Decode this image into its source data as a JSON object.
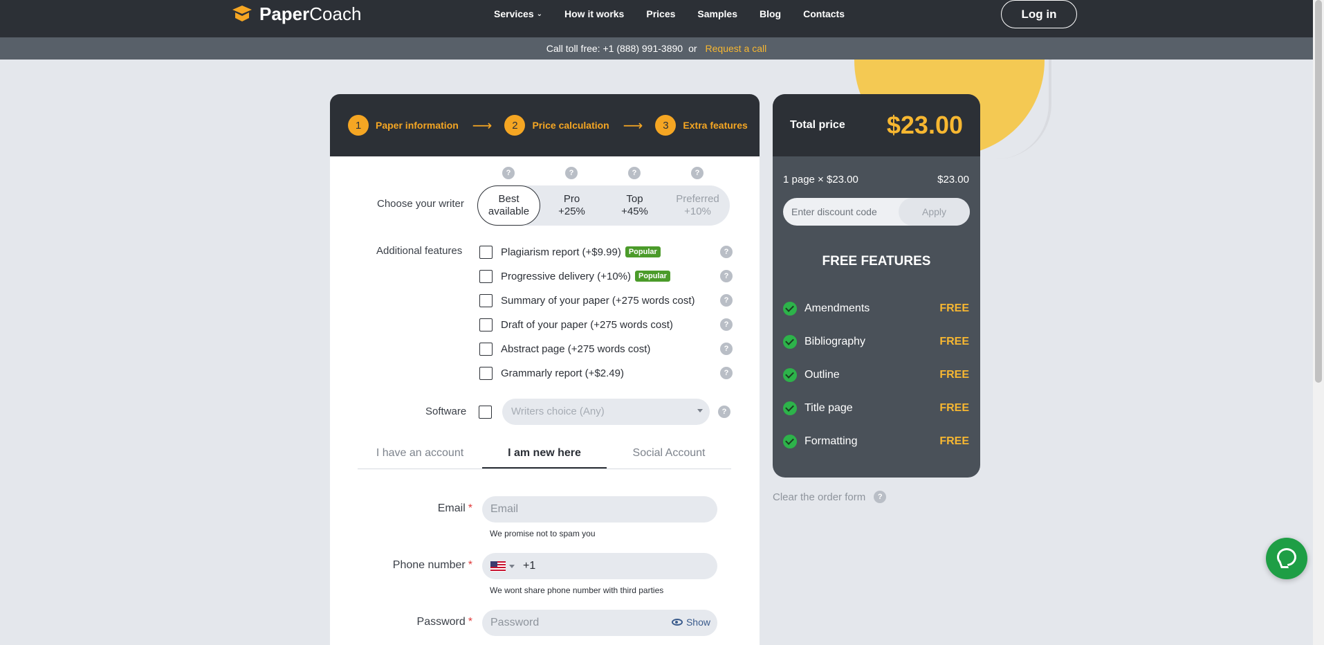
{
  "header": {
    "brand_bold": "Paper",
    "brand_thin": "Coach",
    "nav": [
      "Services",
      "How it works",
      "Prices",
      "Samples",
      "Blog",
      "Contacts"
    ],
    "login_label": "Log in"
  },
  "subbar": {
    "call_text": "Call toll free: +1 (888) 991-3890",
    "or_text": "or",
    "request_label": "Request a call"
  },
  "steps": [
    {
      "num": "1",
      "label": "Paper information"
    },
    {
      "num": "2",
      "label": "Price calculation"
    },
    {
      "num": "3",
      "label": "Extra features"
    }
  ],
  "writer": {
    "label": "Choose your writer",
    "options": [
      {
        "line1": "Best",
        "line2": "available",
        "state": "selected"
      },
      {
        "line1": "Pro",
        "line2": "+25%",
        "state": "normal"
      },
      {
        "line1": "Top",
        "line2": "+45%",
        "state": "normal"
      },
      {
        "line1": "Preferred",
        "line2": "+10%",
        "state": "disabled"
      }
    ]
  },
  "features": {
    "label": "Additional features",
    "popular_badge": "Popular",
    "items": [
      {
        "label": "Plagiarism report (+$9.99)",
        "popular": true
      },
      {
        "label": "Progressive delivery (+10%)",
        "popular": true
      },
      {
        "label": "Summary of your paper (+275 words cost)",
        "popular": false
      },
      {
        "label": "Draft of your paper (+275 words cost)",
        "popular": false
      },
      {
        "label": "Abstract page (+275 words cost)",
        "popular": false
      },
      {
        "label": "Grammarly report (+$2.49)",
        "popular": false
      }
    ]
  },
  "software": {
    "label": "Software",
    "placeholder": "Writers choice (Any)"
  },
  "account_tabs": [
    "I have an account",
    "I am new here",
    "Social Account"
  ],
  "form": {
    "email_label": "Email",
    "email_placeholder": "Email",
    "email_hint": "We promise not to spam you",
    "phone_label": "Phone number",
    "phone_code": "+1",
    "phone_hint": "We wont share phone number with third parties",
    "password_label": "Password",
    "password_placeholder": "Password",
    "show_label": "Show",
    "required_mark": "*"
  },
  "price": {
    "total_label": "Total price",
    "total_value": "$23.00",
    "calc_label": "1 page × $23.00",
    "calc_value": "$23.00",
    "discount_placeholder": "Enter discount code",
    "apply_label": "Apply",
    "free_title": "FREE FEATURES",
    "free_tag": "FREE",
    "free_items": [
      "Amendments",
      "Bibliography",
      "Outline",
      "Title page",
      "Formatting"
    ]
  },
  "clear_form_label": "Clear the order form",
  "help_glyph": "?",
  "colors": {
    "accent": "#f5a623",
    "dark": "#2c3036",
    "panel": "#4a5159",
    "popular": "#4b9b2a",
    "chat": "#1e9e45"
  }
}
